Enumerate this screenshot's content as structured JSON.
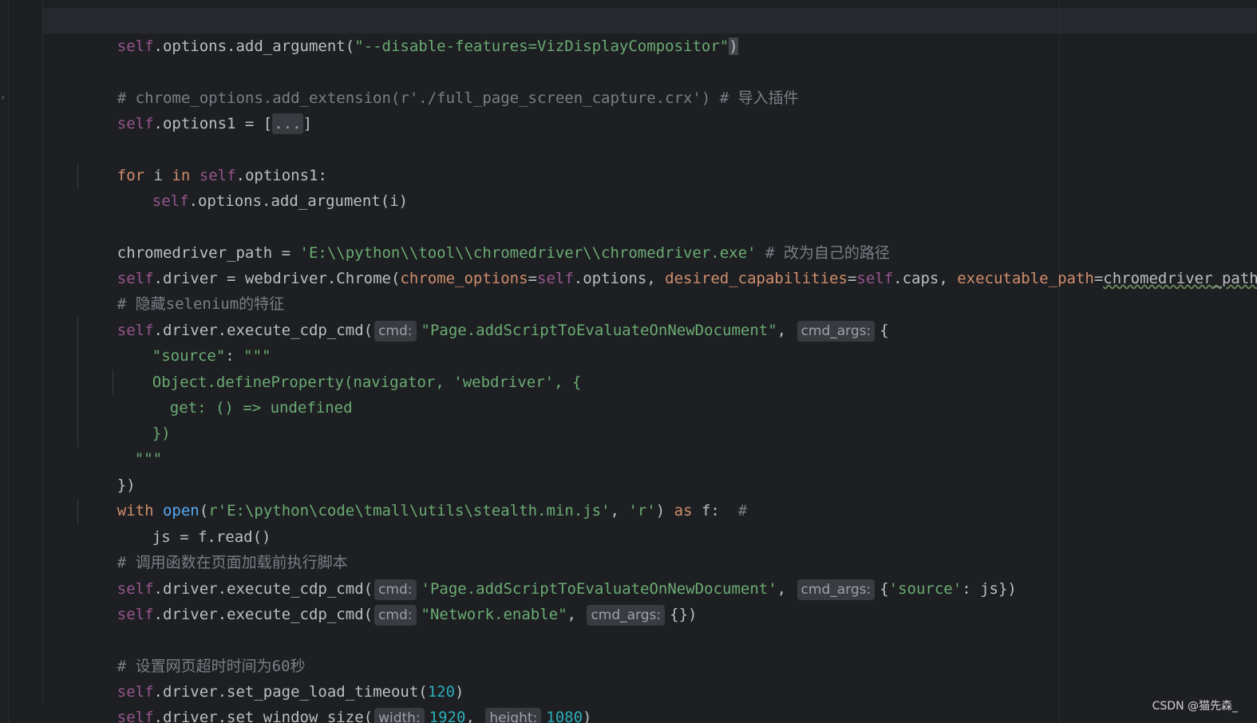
{
  "code_lines": [
    {
      "id": 0,
      "parts": [
        "self",
        ".options.add_argument(",
        "\"--disable-features=VizDisplayCompositor\"",
        ")"
      ]
    },
    {
      "id": 1,
      "parts": [
        "# chrome_options.add_extension(r'./full_page_screen_capture.crx') # 导入插件"
      ]
    },
    {
      "id": 2,
      "parts": [
        "self",
        ".options1 = [",
        "...",
        "]"
      ]
    },
    {
      "id": 3,
      "parts": [
        "for",
        " i ",
        "in",
        " ",
        "self",
        ".options1:"
      ]
    },
    {
      "id": 4,
      "parts": [
        "self",
        ".options.add_argument(i)"
      ]
    },
    {
      "id": 5,
      "parts": [
        "chromedriver_path = ",
        "'E:\\\\python\\\\tool\\\\chromedriver\\\\chromedriver.exe'",
        " # 改为自己的路径"
      ]
    },
    {
      "id": 6,
      "parts": [
        "self",
        ".driver = webdriver.Chrome(",
        "chrome_options",
        "=",
        "self",
        ".options, ",
        "desired_capabilities",
        "=",
        "self",
        ".caps, ",
        "executable_path",
        "=",
        "chromedriver_path",
        ")"
      ]
    },
    {
      "id": 7,
      "parts": [
        "# 隐藏selenium的特征"
      ]
    },
    {
      "id": 8,
      "parts": [
        "self",
        ".driver.execute_cdp_cmd(",
        "cmd:",
        "\"Page.addScriptToEvaluateOnNewDocument\"",
        ", ",
        "cmd_args:",
        "{"
      ]
    },
    {
      "id": 9,
      "parts": [
        "\"source\"",
        ": ",
        "\"\"\""
      ]
    },
    {
      "id": 10,
      "parts": [
        "Object.defineProperty(navigator, 'webdriver', {"
      ]
    },
    {
      "id": 11,
      "parts": [
        "get: () => undefined"
      ]
    },
    {
      "id": 12,
      "parts": [
        "})"
      ]
    },
    {
      "id": 13,
      "parts": [
        "\"\"\""
      ]
    },
    {
      "id": 14,
      "parts": [
        "})"
      ]
    },
    {
      "id": 15,
      "parts": [
        "with",
        " ",
        "open",
        "(",
        "r'E:\\python\\code\\tmall\\utils\\stealth.min.js'",
        ", ",
        "'r'",
        ") ",
        "as",
        " f:  ",
        "#"
      ]
    },
    {
      "id": 16,
      "parts": [
        "js = f.read()"
      ]
    },
    {
      "id": 17,
      "parts": [
        "# 调用函数在页面加载前执行脚本"
      ]
    },
    {
      "id": 18,
      "parts": [
        "self",
        ".driver.execute_cdp_cmd(",
        "cmd:",
        "'Page.addScriptToEvaluateOnNewDocument'",
        ", ",
        "cmd_args:",
        "{",
        "'source'",
        ": js})"
      ]
    },
    {
      "id": 19,
      "parts": [
        "self",
        ".driver.execute_cdp_cmd(",
        "cmd:",
        "\"Network.enable\"",
        ", ",
        "cmd_args:",
        "{})"
      ]
    },
    {
      "id": 20,
      "parts": [
        "# 设置网页超时时间为60秒"
      ]
    },
    {
      "id": 21,
      "parts": [
        "self",
        ".driver.set_page_load_timeout(",
        "120",
        ")"
      ]
    },
    {
      "id": 22,
      "parts": [
        "self",
        ".driver.set_window_size(",
        "width:",
        "1920",
        ", ",
        "height:",
        "1080",
        ")"
      ]
    }
  ],
  "watermark": "CSDN @猫先森_",
  "colors": {
    "background": "#1e1f22",
    "keyword": "#cf8e6d",
    "string": "#6aab73",
    "comment": "#7a7e85",
    "number": "#2aacb8",
    "named_arg": "#c77dbb",
    "self": "#94558d"
  }
}
